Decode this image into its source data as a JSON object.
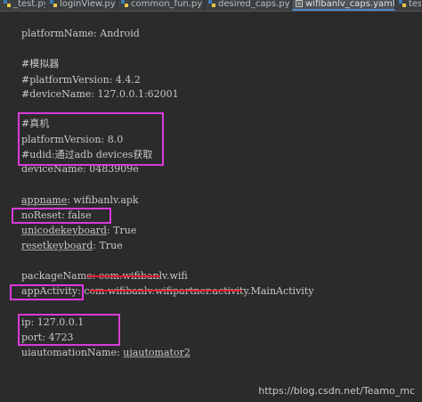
{
  "tabs": [
    {
      "label": "_test.py",
      "icon": "python-file-icon",
      "active": false
    },
    {
      "label": "loginView.py",
      "icon": "python-file-icon",
      "active": false
    },
    {
      "label": "common_fun.py",
      "icon": "python-file-icon",
      "active": false
    },
    {
      "label": "desired_caps.py",
      "icon": "python-file-icon",
      "active": false
    },
    {
      "label": "wifibanlv_caps.yaml",
      "icon": "yaml-file-icon",
      "active": true
    },
    {
      "label": "tes",
      "icon": "python-file-icon",
      "active": false
    }
  ],
  "code": {
    "platformName": "platformName: Android",
    "comment_emulator": "#模拟器",
    "platformVersion_commented": "#platformVersion: 4.4.2",
    "deviceName_commented": "#deviceName: 127.0.0.1:62001",
    "comment_real": "#真机",
    "platformVersion": "platformVersion: 8.0",
    "udid_comment": "#udid:通过adb devices获取",
    "deviceName": "deviceName: 0483909e",
    "appname_key": "appname",
    "appname_value": ": wifibanlv.apk",
    "noReset": "noReset: false",
    "unicodekeyboard_key": "unicodekeyboard",
    "unicodekeyboard_value": ": True",
    "resetkeyboard_key": "resetkeyboard",
    "resetkeyboard_value": ": True",
    "packageName_key": "packageName",
    "packageName_value": ": com.wifibanlv.wifi",
    "appActivity_key": "appActivity",
    "appActivity_value": ": com.wifibanlv.wifipartner.activity.MainActivity",
    "ip": "ip: 127.0.0.1",
    "port": "port: 4723",
    "uiautomationName_key": "uiautomationName",
    "uiautomationName_sep": ": ",
    "uiautomationName_value": "uiautomator2"
  },
  "watermark": "https://blog.csdn.net/Teamo_mc",
  "colors": {
    "background": "#2b2b2b",
    "text": "#c9c9c9",
    "highlight_box": "#d93bd9",
    "redaction": "#e0202a"
  }
}
